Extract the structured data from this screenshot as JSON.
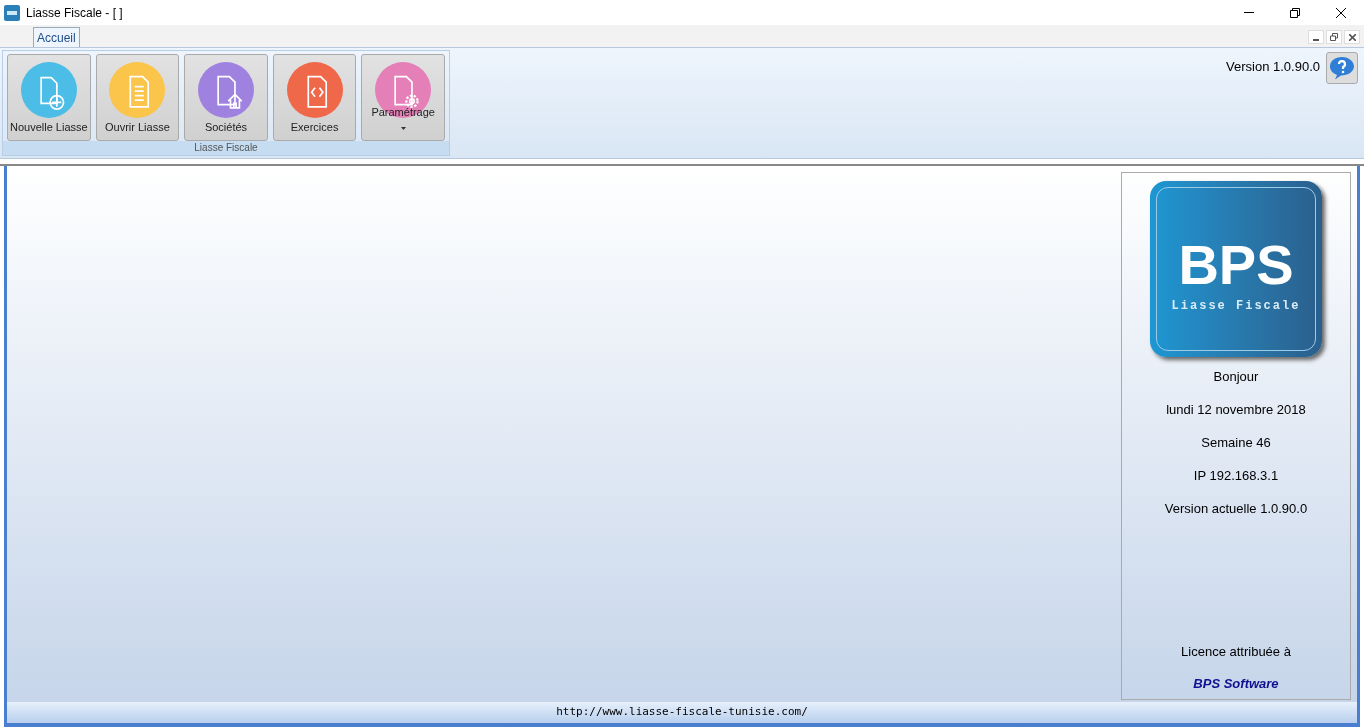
{
  "window": {
    "title": "Liasse Fiscale - [ ]"
  },
  "tabs": [
    {
      "label": "Accueil",
      "selected": true
    }
  ],
  "ribbon": {
    "group_label": "Liasse Fiscale",
    "version": "Version 1.0.90.0",
    "buttons": [
      {
        "label": "Nouvelle Liasse",
        "kind": "new",
        "color": "#4bbde6",
        "dropdown": false
      },
      {
        "label": "Ouvrir Liasse",
        "kind": "open",
        "color": "#fbc44a",
        "dropdown": false
      },
      {
        "label": "Sociétés",
        "kind": "company",
        "color": "#9f82e0",
        "dropdown": false
      },
      {
        "label": "Exercices",
        "kind": "code",
        "color": "#f0684a",
        "dropdown": false
      },
      {
        "label": "Paramétrage",
        "kind": "settings",
        "color": "#e57fb8",
        "dropdown": true
      }
    ]
  },
  "info_panel": {
    "logo_title": "BPS",
    "logo_subtitle": "Liasse Fiscale",
    "lines": [
      "Bonjour",
      "lundi 12 novembre 2018",
      "Semaine 46",
      "IP 192.168.3.1",
      "Version actuelle 1.0.90.0"
    ],
    "licence_label": "Licence attribuée à",
    "licensee": "BPS Software"
  },
  "status_bar": {
    "url": "http://www.liasse-fiscale-tunisie.com/"
  }
}
